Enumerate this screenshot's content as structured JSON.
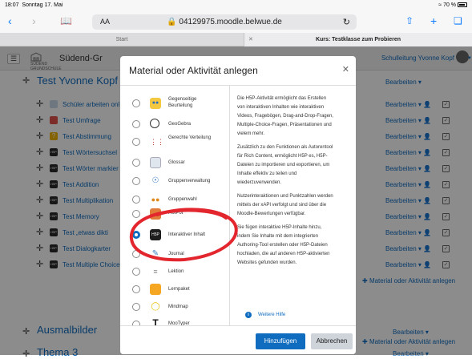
{
  "status_bar": {
    "time": "18:07",
    "date": "Sonntag 17. Mai",
    "battery": "70 %"
  },
  "browser": {
    "url": "04129975.moodle.belwue.de",
    "text_size_label": "AA",
    "tabs": [
      {
        "label": "Start"
      },
      {
        "label": "Kurs: Testklasse zum Probieren"
      }
    ]
  },
  "header": {
    "site_name": "Südend-Gr",
    "logo_text": "SÜDEND GRUNDSCHULE",
    "user_menu": "Schulleitung Yvonne Kopf"
  },
  "course": {
    "sections": [
      {
        "title": "Test Yvonne Kopf",
        "edit_label": "Bearbeiten"
      },
      {
        "title": "Ausmalbilder",
        "edit_label": "Bearbeiten"
      },
      {
        "title": "Thema 3",
        "edit_label": "Bearbeiten"
      }
    ],
    "activities": [
      {
        "name": "Schüler arbeiten onl",
        "edit_label": "Bearbeiten"
      },
      {
        "name": "Test Umfrage",
        "edit_label": "Bearbeiten"
      },
      {
        "name": "Test Abstimmung",
        "edit_label": "Bearbeiten"
      },
      {
        "name": "Test Wörtersuchsel",
        "edit_label": "Bearbeiten"
      },
      {
        "name": "Test Wörter markier",
        "edit_label": "Bearbeiten"
      },
      {
        "name": "Test Addition",
        "edit_label": "Bearbeiten"
      },
      {
        "name": "Test Multiplikation",
        "edit_label": "Bearbeiten"
      },
      {
        "name": "Test Memory",
        "edit_label": "Bearbeiten"
      },
      {
        "name": "Test „etwas dikti",
        "edit_label": "Bearbeiten"
      },
      {
        "name": "Test Dialogkarter",
        "edit_label": "Bearbeiten"
      },
      {
        "name": "Test Multiple Choice",
        "edit_label": "Bearbeiten"
      }
    ],
    "add_material_label": "Material oder Aktivität anlegen"
  },
  "modal": {
    "title": "Material oder Aktivität anlegen",
    "options": [
      {
        "label": "Gegenseitige Beurteilung",
        "icon": "peer-assessment-icon"
      },
      {
        "label": "GeoGebra",
        "icon": "geogebra-icon"
      },
      {
        "label": "Gerechte Verteilung",
        "icon": "ratingallocate-icon"
      },
      {
        "label": "Glossar",
        "icon": "glossary-icon"
      },
      {
        "label": "Gruppenverwaltung",
        "icon": "group-management-icon"
      },
      {
        "label": "Gruppenwahl",
        "icon": "group-choice-icon"
      },
      {
        "label": "HotPot",
        "icon": "hotpot-icon"
      },
      {
        "label": "Interaktiver Inhalt",
        "icon": "h5p-icon"
      },
      {
        "label": "Journal",
        "icon": "journal-icon"
      },
      {
        "label": "Lektion",
        "icon": "lesson-icon"
      },
      {
        "label": "Lernpaket",
        "icon": "scorm-icon"
      },
      {
        "label": "Mindmap",
        "icon": "mindmap-icon"
      },
      {
        "label": "MooTyper",
        "icon": "mootyper-icon"
      }
    ],
    "selected_option": "Interaktiver Inhalt",
    "description": [
      "Die H5P-Aktivität ermöglicht das Erstellen",
      "von interaktiven Inhalten wie interaktiven",
      "Videos, Fragebögen, Drag-and-Drop-Fragen,",
      "Multiple-Choice-Fragen, Präsentationen und",
      "vielem mehr.",
      "",
      "Zusätzlich zu den Funktionen als Autorentool",
      "für Rich Content, ermöglicht H5P es, H5P-",
      "Dateien zu importieren und exportieren, um",
      "Inhalte effektiv zu teilen und",
      "wiederzuverwenden.",
      "",
      "Nutzerinteraktionen und Punktzahlen werden",
      "mittels der xAPI verfolgt und sind über die",
      "Moodle-Bewertungen verfügbar.",
      "",
      "Sie fügen interaktive H5P-Inhalte hinzu,",
      "indem Sie Inhalte mit dem integrierten",
      "Authoring-Tool erstellen oder H5P-Dateien",
      "hochladen, die auf anderen H5P-aktivierten",
      "Websites gefunden wurden."
    ],
    "help_link": "Weitere Hilfe",
    "add_button": "Hinzufügen",
    "cancel_button": "Abbrechen"
  },
  "colors": {
    "accent": "#0f6cbf",
    "annotation": "#e3262e"
  }
}
